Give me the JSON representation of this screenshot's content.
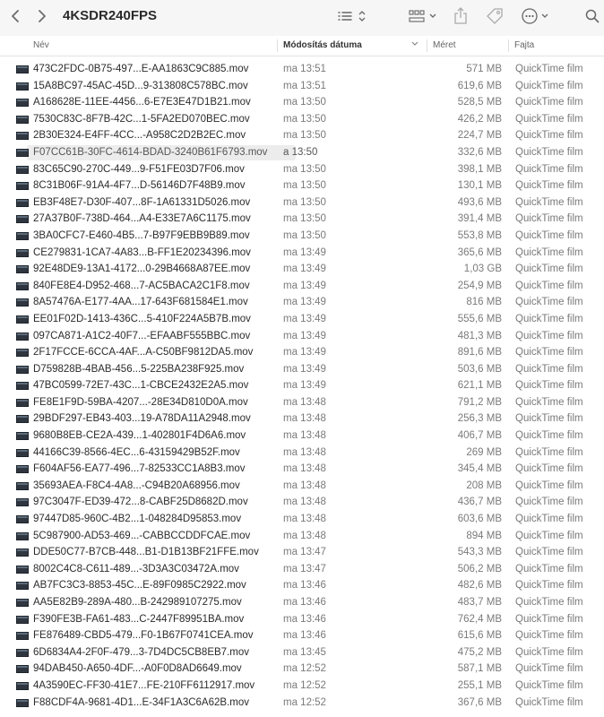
{
  "window": {
    "title": "4KSDR240FPS"
  },
  "toolbar": {
    "back_icon": "chevron-left-icon",
    "forward_icon": "chevron-right-icon",
    "list_view_icon": "list-view-icon",
    "gallery_icon": "gallery-grid-icon",
    "share_icon": "share-icon",
    "tag_icon": "tag-icon",
    "more_icon": "ellipsis-circle-icon",
    "search_icon": "search-icon"
  },
  "columns": {
    "name": "Név",
    "date": "Módosítás dátuma",
    "size": "Méret",
    "kind": "Fajta"
  },
  "files": [
    {
      "name": "473C2FDC-0B75-497...E-AA1863C9C885.mov",
      "date": "ma 13:51",
      "size": "571 MB",
      "kind": "QuickTime film"
    },
    {
      "name": "15A8BC97-45AC-45D...9-313808C578BC.mov",
      "date": "ma 13:51",
      "size": "619,6 MB",
      "kind": "QuickTime film"
    },
    {
      "name": "A168628E-11EE-4456...6-E7E3E47D1B21.mov",
      "date": "ma 13:50",
      "size": "528,5 MB",
      "kind": "QuickTime film"
    },
    {
      "name": "7530C83C-8F7B-42C...1-5FA2ED070BEC.mov",
      "date": "ma 13:50",
      "size": "426,2 MB",
      "kind": "QuickTime film"
    },
    {
      "name": "2B30E324-E4FF-4CC...-A958C2D2B2EC.mov",
      "date": "ma 13:50",
      "size": "224,7 MB",
      "kind": "QuickTime film"
    },
    {
      "name": "F07CC61B-30FC-4614-BDAD-3240B61F6793.mov",
      "date": "a 13:50",
      "size": "332,6 MB",
      "kind": "QuickTime film"
    },
    {
      "name": "83C65C90-270C-449...9-F51FE03D7F06.mov",
      "date": "ma 13:50",
      "size": "398,1 MB",
      "kind": "QuickTime film"
    },
    {
      "name": "8C31B06F-91A4-4F7...D-56146D7F48B9.mov",
      "date": "ma 13:50",
      "size": "130,1 MB",
      "kind": "QuickTime film"
    },
    {
      "name": "EB3F48E7-D30F-407...8F-1A61331D5026.mov",
      "date": "ma 13:50",
      "size": "493,6 MB",
      "kind": "QuickTime film"
    },
    {
      "name": "27A37B0F-738D-464...A4-E33E7A6C1175.mov",
      "date": "ma 13:50",
      "size": "391,4 MB",
      "kind": "QuickTime film"
    },
    {
      "name": "3BA0CFC7-E460-4B5...7-B97F9EBB9B89.mov",
      "date": "ma 13:50",
      "size": "553,8 MB",
      "kind": "QuickTime film"
    },
    {
      "name": "CE279831-1CA7-4A83...B-FF1E20234396.mov",
      "date": "ma 13:49",
      "size": "365,6 MB",
      "kind": "QuickTime film"
    },
    {
      "name": "92E48DE9-13A1-4172...0-29B4668A87EE.mov",
      "date": "ma 13:49",
      "size": "1,03 GB",
      "kind": "QuickTime film"
    },
    {
      "name": "840FE8E4-D952-468...7-AC5BACA2C1F8.mov",
      "date": "ma 13:49",
      "size": "254,9 MB",
      "kind": "QuickTime film"
    },
    {
      "name": "8A57476A-E177-4AA...17-643F681584E1.mov",
      "date": "ma 13:49",
      "size": "816 MB",
      "kind": "QuickTime film"
    },
    {
      "name": "EE01F02D-1413-436C...5-410F224A5B7B.mov",
      "date": "ma 13:49",
      "size": "555,6 MB",
      "kind": "QuickTime film"
    },
    {
      "name": "097CA871-A1C2-40F7...-EFAABF555BBC.mov",
      "date": "ma 13:49",
      "size": "481,3 MB",
      "kind": "QuickTime film"
    },
    {
      "name": "2F17FCCE-6CCA-4AF...A-C50BF9812DA5.mov",
      "date": "ma 13:49",
      "size": "891,6 MB",
      "kind": "QuickTime film"
    },
    {
      "name": "D759828B-4BAB-456...5-225BA238F925.mov",
      "date": "ma 13:49",
      "size": "503,6 MB",
      "kind": "QuickTime film"
    },
    {
      "name": "47BC0599-72E7-43C...1-CBCE2432E2A5.mov",
      "date": "ma 13:49",
      "size": "621,1 MB",
      "kind": "QuickTime film"
    },
    {
      "name": "FE8E1F9D-59BA-4207...-28E34D810D0A.mov",
      "date": "ma 13:48",
      "size": "791,2 MB",
      "kind": "QuickTime film"
    },
    {
      "name": "29BDF297-EB43-403...19-A78DA11A2948.mov",
      "date": "ma 13:48",
      "size": "256,3 MB",
      "kind": "QuickTime film"
    },
    {
      "name": "9680B8EB-CE2A-439...1-402801F4D6A6.mov",
      "date": "ma 13:48",
      "size": "406,7 MB",
      "kind": "QuickTime film"
    },
    {
      "name": "44166C39-8566-4EC...6-43159429B52F.mov",
      "date": "ma 13:48",
      "size": "269 MB",
      "kind": "QuickTime film"
    },
    {
      "name": "F604AF56-EA77-496...7-82533CC1A8B3.mov",
      "date": "ma 13:48",
      "size": "345,4 MB",
      "kind": "QuickTime film"
    },
    {
      "name": "35693AEA-F8C4-4A8...-C94B20A68956.mov",
      "date": "ma 13:48",
      "size": "208 MB",
      "kind": "QuickTime film"
    },
    {
      "name": "97C3047F-ED39-472...8-CABF25D8682D.mov",
      "date": "ma 13:48",
      "size": "436,7 MB",
      "kind": "QuickTime film"
    },
    {
      "name": "97447D85-960C-4B2...1-048284D95853.mov",
      "date": "ma 13:48",
      "size": "603,6 MB",
      "kind": "QuickTime film"
    },
    {
      "name": "5C987900-AD53-469...-CABBCCDDFCAE.mov",
      "date": "ma 13:48",
      "size": "894 MB",
      "kind": "QuickTime film"
    },
    {
      "name": "DDE50C77-B7CB-448...B1-D1B13BF21FFE.mov",
      "date": "ma 13:47",
      "size": "543,3 MB",
      "kind": "QuickTime film"
    },
    {
      "name": "8002C4C8-C611-489...-3D3A3C03472A.mov",
      "date": "ma 13:47",
      "size": "506,2 MB",
      "kind": "QuickTime film"
    },
    {
      "name": "AB7FC3C3-8853-45C...E-89F0985C2922.mov",
      "date": "ma 13:46",
      "size": "482,6 MB",
      "kind": "QuickTime film"
    },
    {
      "name": "AA5E82B9-289A-480...B-242989107275.mov",
      "date": "ma 13:46",
      "size": "483,7 MB",
      "kind": "QuickTime film"
    },
    {
      "name": "F390FE3B-FA61-483...C-2447F89951BA.mov",
      "date": "ma 13:46",
      "size": "762,4 MB",
      "kind": "QuickTime film"
    },
    {
      "name": "FE876489-CBD5-479...F0-1B67F0741CEA.mov",
      "date": "ma 13:46",
      "size": "615,6 MB",
      "kind": "QuickTime film"
    },
    {
      "name": "6D6834A4-2F0F-479...3-7D4DC5CB8EB7.mov",
      "date": "ma 13:45",
      "size": "475,2 MB",
      "kind": "QuickTime film"
    },
    {
      "name": "94DAB450-A650-4DF...-A0F0D8AD6649.mov",
      "date": "ma 12:52",
      "size": "587,1 MB",
      "kind": "QuickTime film"
    },
    {
      "name": "4A3590EC-FF30-41E7...FE-210FF6112917.mov",
      "date": "ma 12:52",
      "size": "255,1 MB",
      "kind": "QuickTime film"
    },
    {
      "name": "F88CDF4A-9681-4D1...E-34F1A3C6A62B.mov",
      "date": "ma 12:52",
      "size": "367,6 MB",
      "kind": "QuickTime film"
    }
  ],
  "selected_index": 5
}
